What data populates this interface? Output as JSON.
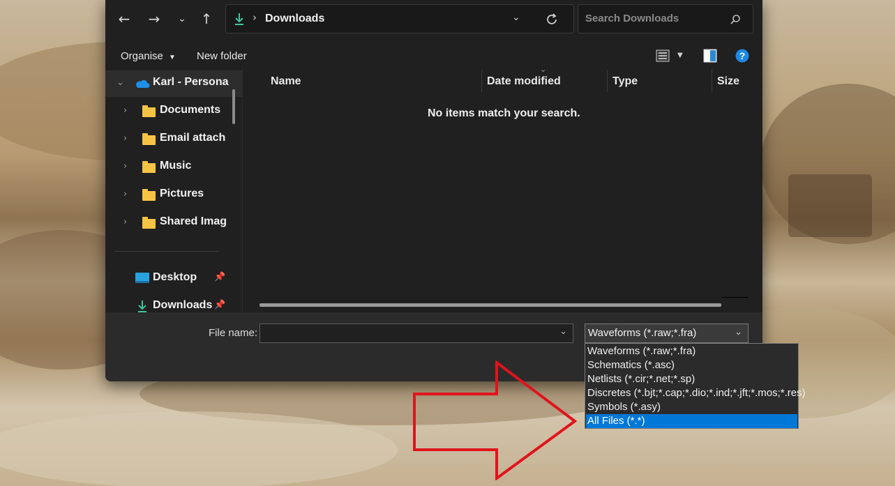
{
  "address": {
    "location": "Downloads",
    "search_placeholder": "Search Downloads"
  },
  "toolbar": {
    "organise_label": "Organise",
    "new_folder_label": "New folder"
  },
  "sidebar": {
    "items": [
      {
        "label": "Karl - Persona",
        "icon": "onedrive-cloud-icon"
      },
      {
        "label": "Documents",
        "icon": "folder-icon"
      },
      {
        "label": "Email attach",
        "icon": "folder-icon"
      },
      {
        "label": "Music",
        "icon": "folder-icon"
      },
      {
        "label": "Pictures",
        "icon": "folder-icon"
      },
      {
        "label": "Shared Imag",
        "icon": "folder-icon"
      }
    ],
    "quick_access": [
      {
        "label": "Desktop",
        "icon": "desktop-icon"
      },
      {
        "label": "Downloads",
        "icon": "download-arrow-icon"
      }
    ]
  },
  "columns": {
    "name": "Name",
    "date_modified": "Date modified",
    "type": "Type",
    "size": "Size"
  },
  "content": {
    "empty_message": "No items match your search."
  },
  "bottom": {
    "file_name_label": "File name:",
    "file_name_value": "",
    "filter_selected": "Waveforms (*.raw;*.fra)"
  },
  "dropdown": {
    "options": [
      "Waveforms (*.raw;*.fra)",
      "Schematics (*.asc)",
      "Netlists (*.cir;*.net;*.sp)",
      "Discretes (*.bjt;*.cap;*.dio;*.ind;*.jft;*.mos;*.res)",
      "Symbols (*.asy)",
      "All Files (*.*)"
    ],
    "highlighted": "All Files (*.*)"
  },
  "colors": {
    "dialog_bg": "#202020",
    "accent": "#0078d7",
    "arrow": "#e0141c",
    "folder": "#f6c445",
    "download_green": "#3cc8a0"
  }
}
